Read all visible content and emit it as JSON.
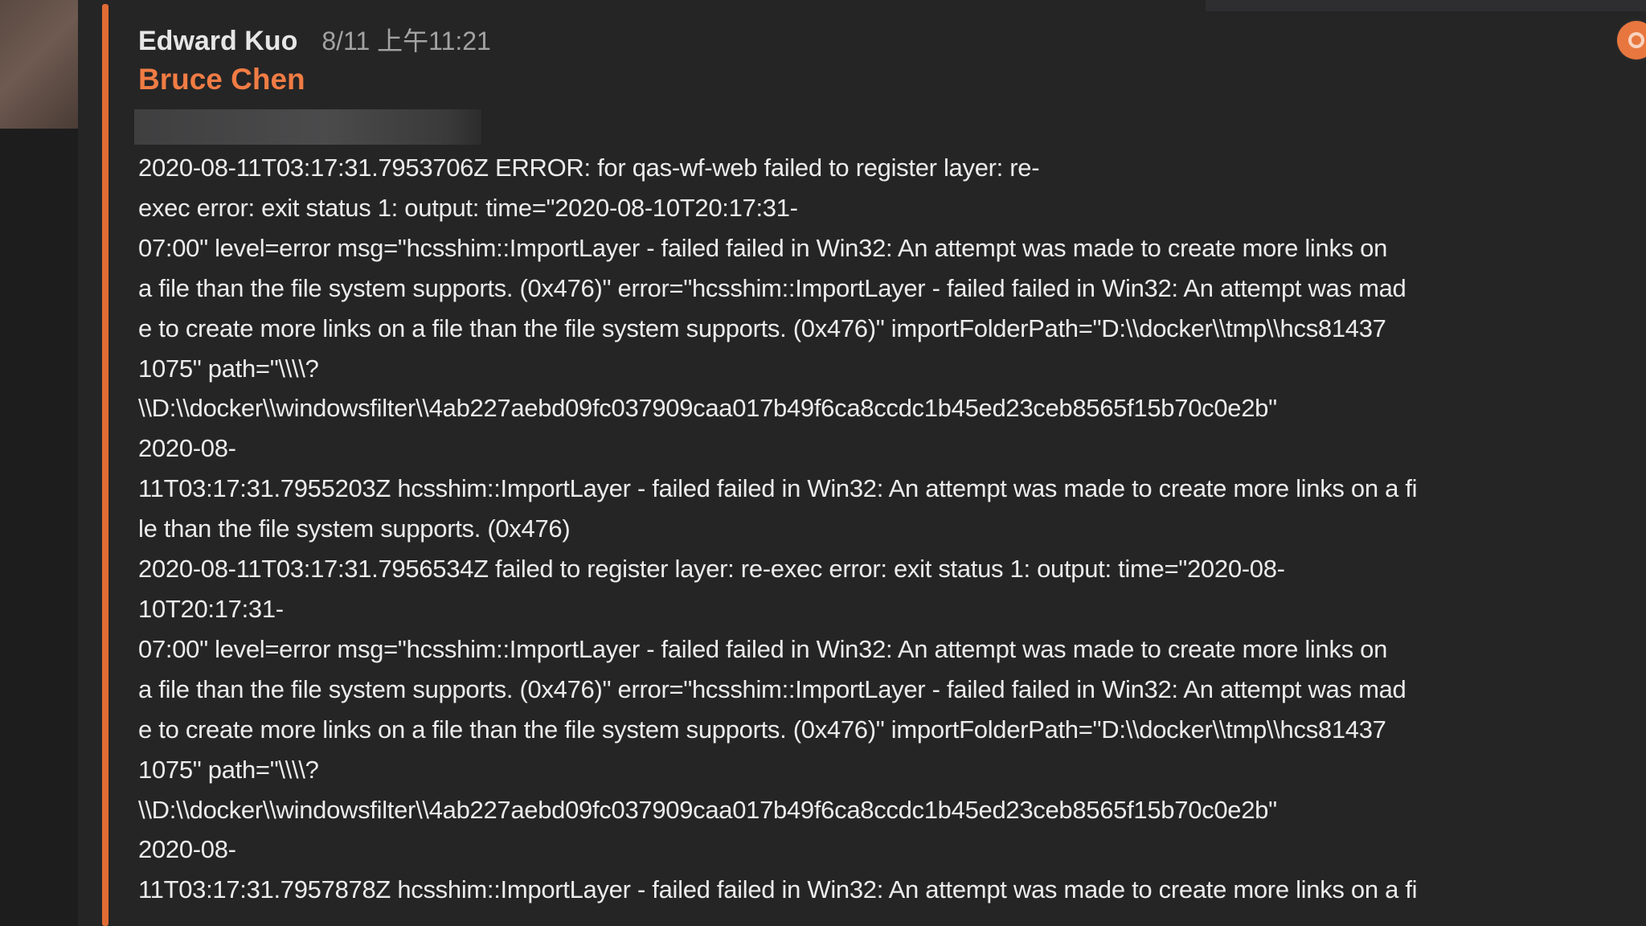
{
  "message": {
    "author": "Edward Kuo",
    "timestamp": "8/11 上午11:21",
    "mention": "Bruce Chen",
    "lines": [
      "2020-08-11T03:17:31.7953706Z ERROR: for qas-wf-web  failed to register layer: re-",
      "exec error: exit status 1: output: time=\"2020-08-10T20:17:31-",
      "07:00\" level=error msg=\"hcsshim::ImportLayer - failed failed in Win32: An attempt was made to create more links on",
      "a file than the file system supports. (0x476)\" error=\"hcsshim::ImportLayer - failed failed in Win32: An attempt was mad",
      "e to create more links on a file than the file system supports. (0x476)\" importFolderPath=\"D:\\\\docker\\\\tmp\\\\hcs81437",
      "1075\" path=\"\\\\\\\\?",
      "\\\\D:\\\\docker\\\\windowsfilter\\\\4ab227aebd09fc037909caa017b49f6ca8ccdc1b45ed23ceb8565f15b70c0e2b\"",
      "2020-08-",
      "11T03:17:31.7955203Z hcsshim::ImportLayer - failed failed in Win32: An attempt was made to create more links on a fi",
      "le than the file system supports. (0x476)",
      "2020-08-11T03:17:31.7956534Z failed to register layer: re-exec error: exit status 1: output: time=\"2020-08-",
      "10T20:17:31-",
      "07:00\" level=error msg=\"hcsshim::ImportLayer - failed failed in Win32: An attempt was made to create more links on",
      "a file than the file system supports. (0x476)\" error=\"hcsshim::ImportLayer - failed failed in Win32: An attempt was mad",
      "e to create more links on a file than the file system supports. (0x476)\" importFolderPath=\"D:\\\\docker\\\\tmp\\\\hcs81437",
      "1075\" path=\"\\\\\\\\?",
      "\\\\D:\\\\docker\\\\windowsfilter\\\\4ab227aebd09fc037909caa017b49f6ca8ccdc1b45ed23ceb8565f15b70c0e2b\"",
      "2020-08-",
      "11T03:17:31.7957878Z hcsshim::ImportLayer - failed failed in Win32: An attempt was made to create more links on a fi"
    ]
  },
  "colors": {
    "background": "#252526",
    "accent": "#e06c34",
    "mention": "#f07c44",
    "text": "#ececec"
  },
  "icons": {
    "reaction": "reaction-icon"
  }
}
